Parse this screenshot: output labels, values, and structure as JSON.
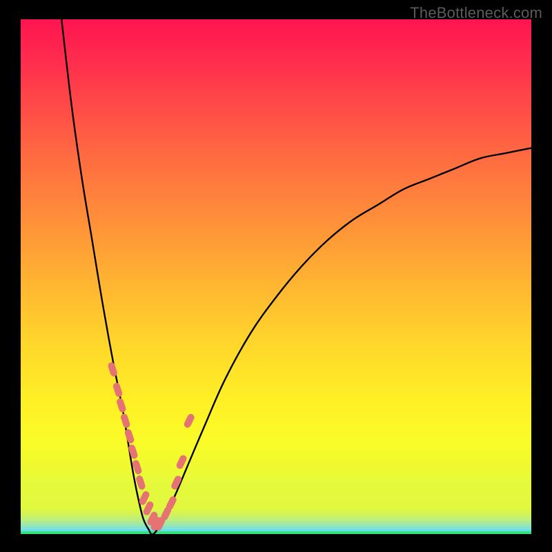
{
  "watermark": {
    "text": "TheBottleneck.com"
  },
  "colors": {
    "page_bg": "#000000",
    "curve_stroke": "#000000",
    "marker_fill": "#E57373",
    "marker_stroke": "#E57373",
    "bottom_bands": [
      "#daf64a",
      "#d4f456",
      "#ccf264",
      "#c2f074",
      "#b6ed87",
      "#a7ea9d",
      "#96e7b5",
      "#82e3d0",
      "#68def0",
      "#32e27e"
    ]
  },
  "chart_data": {
    "type": "line",
    "title": "",
    "xlabel": "",
    "ylabel": "",
    "xlim": [
      0,
      100
    ],
    "ylim": [
      0,
      100
    ],
    "note": "Single V-shaped bottleneck curve on a red→yellow→green vertical gradient. Y is 'distance from optimal' (0 at the dip = perfect match, 100 at the top = worst). Curve minimum is near x≈24, y≈0. Left arm is steep and hits y=100 around x≈8. Right arm is shallower and asymptotically approaches y≈75 by x=100. Salmon dot markers cluster along both arms near the bottom (roughly y 3–32).",
    "series": [
      {
        "name": "bottleneck-curve",
        "x": [
          8,
          10,
          12,
          14,
          16,
          18,
          20,
          21,
          22,
          23,
          24,
          25,
          26,
          28,
          30,
          33,
          36,
          40,
          45,
          50,
          55,
          60,
          65,
          70,
          75,
          80,
          85,
          90,
          95,
          100
        ],
        "y": [
          100,
          83,
          69,
          57,
          45,
          34,
          24,
          18,
          12,
          7,
          3,
          1,
          0,
          3,
          7,
          14,
          21,
          30,
          39,
          46,
          52,
          57,
          61,
          64,
          67,
          69,
          71,
          73,
          74,
          75
        ]
      }
    ],
    "markers": {
      "name": "highlighted-points",
      "x": [
        18,
        19,
        19.7,
        20.5,
        21.3,
        22,
        22.8,
        23.5,
        24.2,
        25,
        25.8,
        26.5,
        27.3,
        28.5,
        29.5,
        30.5,
        31.5,
        33
      ],
      "y": [
        32,
        28,
        25,
        22,
        19,
        16,
        13,
        10,
        7,
        5,
        3,
        2,
        2,
        4,
        6,
        10,
        14,
        22
      ]
    }
  }
}
